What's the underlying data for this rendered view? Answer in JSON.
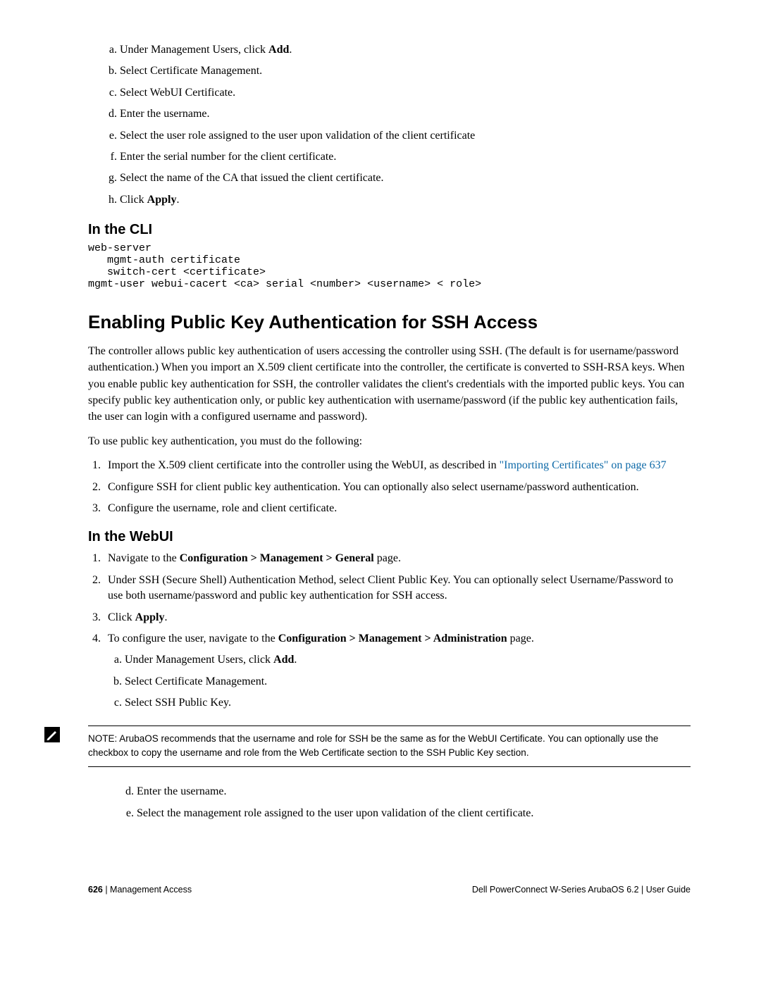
{
  "list1": {
    "a": {
      "pre": "Under Management Users, click ",
      "bold": "Add",
      "post": "."
    },
    "b": "Select Certificate Management.",
    "c": "Select WebUI Certificate.",
    "d": "Enter the username.",
    "e": "Select the user role assigned to the user upon validation of the client certificate",
    "f": "Enter the serial number for the client certificate.",
    "g": "Select the name of the CA that issued the client certificate.",
    "h": {
      "pre": "Click ",
      "bold": "Apply",
      "post": "."
    }
  },
  "h2_cli": "In the CLI",
  "cli": "web-server\n   mgmt-auth certificate\n   switch-cert <certificate>\nmgmt-user webui-cacert <ca> serial <number> <username> < role>",
  "h1_ssh": "Enabling Public Key Authentication for SSH Access",
  "para1": "The controller allows public key authentication of users accessing the controller using SSH. (The default is for username/password authentication.) When you import an X.509 client certificate into the controller, the certificate is converted to SSH-RSA keys. When you enable public key authentication for SSH, the controller validates the client's credentials with the imported public keys. You can specify public key authentication only, or public key authentication with username/password (if the public key authentication fails, the user can login with a configured username and password).",
  "para2": "To use public key authentication, you must do the following:",
  "olist1": {
    "1": {
      "pre": "Import the X.509 client certificate into the controller using the WebUI, as described in ",
      "link": "\"Importing Certificates\" on page 637"
    },
    "2": "Configure SSH for client public key authentication. You can optionally also select username/password authentication.",
    "3": "Configure the username, role and client certificate."
  },
  "h2_webui": "In the WebUI",
  "olist2": {
    "1": {
      "pre": "Navigate to the ",
      "bold": "Configuration > Management > General",
      "post": " page."
    },
    "2": "Under SSH (Secure Shell) Authentication Method, select Client Public Key. You can optionally select Username/Password to use both username/password and public key authentication for SSH access.",
    "3": {
      "pre": "Click ",
      "bold": "Apply",
      "post": "."
    },
    "4": {
      "pre": "To configure the user, navigate to the ",
      "bold": "Configuration > Management > Administration",
      "post": " page."
    }
  },
  "sub4": {
    "a": {
      "pre": "Under Management Users, click ",
      "bold": "Add",
      "post": "."
    },
    "b": "Select Certificate Management.",
    "c": "Select SSH Public Key."
  },
  "note": "NOTE: ArubaOS recommends that the username and role for SSH be the same as for the WebUI Certificate. You can optionally use the checkbox to copy the username and role from the Web Certificate section to the SSH Public Key section.",
  "sub4b": {
    "d": "Enter the username.",
    "e": "Select the management role assigned to the user upon validation of the client certificate."
  },
  "footer": {
    "page": "626",
    "left": " | Management Access",
    "right": "Dell PowerConnect W-Series ArubaOS 6.2  |  User Guide"
  }
}
